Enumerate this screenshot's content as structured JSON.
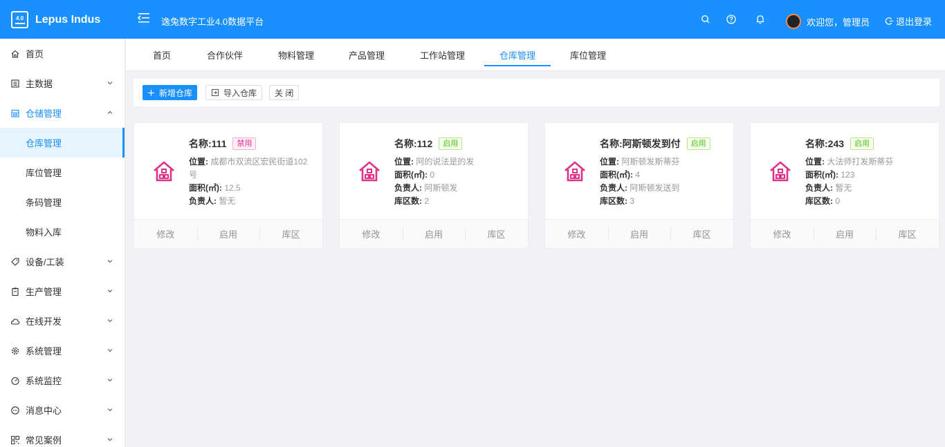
{
  "app": {
    "logo_badge": "4.0",
    "logo_name": "Lepus Indus",
    "platform_title": "逸兔数字工业4.0数据平台",
    "welcome": "欢迎您，管理员",
    "logout": "退出登录"
  },
  "sidebar": {
    "items": [
      {
        "label": "首页"
      },
      {
        "label": "主数据"
      },
      {
        "label": "仓储管理"
      },
      {
        "label": "设备/工装"
      },
      {
        "label": "生产管理"
      },
      {
        "label": "在线开发"
      },
      {
        "label": "系统管理"
      },
      {
        "label": "系统监控"
      },
      {
        "label": "消息中心"
      },
      {
        "label": "常见案例"
      }
    ],
    "sub_items": [
      {
        "label": "仓库管理"
      },
      {
        "label": "库位管理"
      },
      {
        "label": "条码管理"
      },
      {
        "label": "物料入库"
      }
    ]
  },
  "tabs": [
    {
      "label": "首页"
    },
    {
      "label": "合作伙伴"
    },
    {
      "label": "物料管理"
    },
    {
      "label": "产品管理"
    },
    {
      "label": "工作站管理"
    },
    {
      "label": "仓库管理"
    },
    {
      "label": "库位管理"
    }
  ],
  "toolbar": {
    "add": "新增仓库",
    "import": "导入仓库",
    "close": "关 闭"
  },
  "labels": {
    "location": "位置:",
    "area": "面积(㎡):",
    "manager": "负责人:",
    "zones": "库区数:"
  },
  "actions": {
    "edit": "修改",
    "enable": "启用",
    "zone": "库区"
  },
  "cards": [
    {
      "title": "名称:111",
      "status": "禁用",
      "location": "成都市双流区宏民街道102号",
      "area": "12.5",
      "manager": "暂无",
      "zones": ""
    },
    {
      "title": "名称:112",
      "status": "启用",
      "location": "阿的说法是的发",
      "area": "0",
      "manager": "阿斯顿发",
      "zones": "2"
    },
    {
      "title": "名称:阿斯顿发到付",
      "status": "启用",
      "location": "阿斯顿发斯蒂芬",
      "area": "4",
      "manager": "阿斯顿发送到",
      "zones": "3"
    },
    {
      "title": "名称:243",
      "status": "启用",
      "location": "大法师打发斯蒂芬",
      "area": "123",
      "manager": "暂无",
      "zones": "0"
    }
  ],
  "colors": {
    "primary": "#1890ff",
    "house_icon": "#e0318a",
    "tag_disabled": "#eb2f96",
    "tag_enabled": "#52c41a"
  }
}
